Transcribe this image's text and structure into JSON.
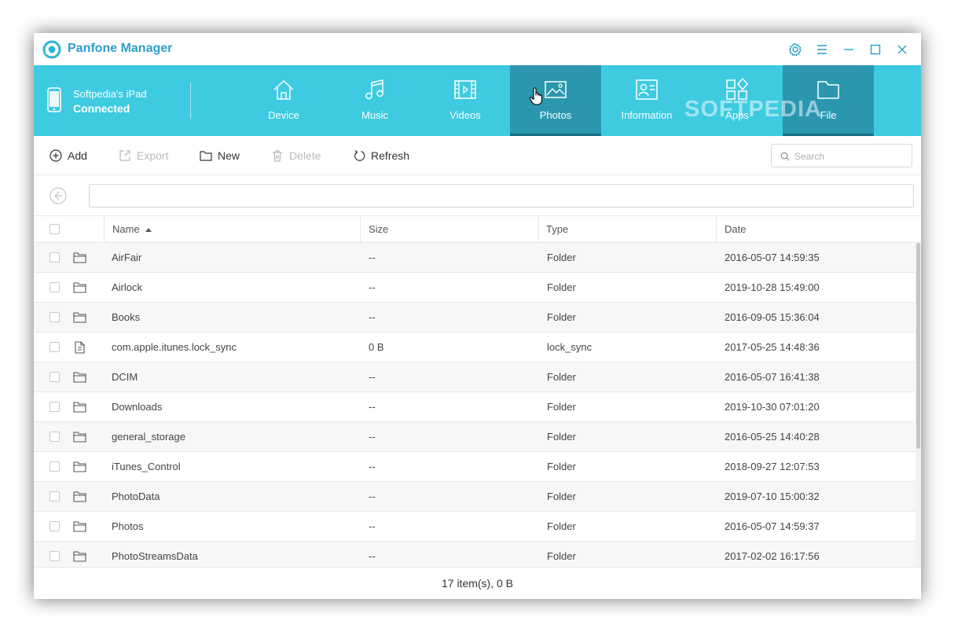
{
  "app": {
    "title": "Panfone Manager"
  },
  "device": {
    "name": "Softpedia's iPad",
    "status": "Connected"
  },
  "nav": {
    "tabs": [
      {
        "label": "Device",
        "icon": "home-icon"
      },
      {
        "label": "Music",
        "icon": "music-note-icon"
      },
      {
        "label": "Videos",
        "icon": "video-icon"
      },
      {
        "label": "Photos",
        "icon": "image-icon"
      },
      {
        "label": "Information",
        "icon": "contact-card-icon"
      },
      {
        "label": "Apps",
        "icon": "apps-grid-icon"
      },
      {
        "label": "File",
        "icon": "folder-icon"
      }
    ],
    "active_tab": "File",
    "hovered_tab": "Photos"
  },
  "watermark": "SOFTPEDIA",
  "toolbar": {
    "add": "Add",
    "export": "Export",
    "new": "New",
    "delete": "Delete",
    "refresh": "Refresh",
    "search_placeholder": "Search"
  },
  "path": {
    "value": ""
  },
  "table": {
    "columns": {
      "name": "Name",
      "size": "Size",
      "type": "Type",
      "date": "Date"
    },
    "sort": {
      "column": "Name",
      "direction": "ascending"
    },
    "rows": [
      {
        "icon": "folder-icon",
        "name": "AirFair",
        "size": "--",
        "type": "Folder",
        "date": "2016-05-07 14:59:35"
      },
      {
        "icon": "folder-icon",
        "name": "Airlock",
        "size": "--",
        "type": "Folder",
        "date": "2019-10-28 15:49:00"
      },
      {
        "icon": "folder-icon",
        "name": "Books",
        "size": "--",
        "type": "Folder",
        "date": "2016-09-05 15:36:04"
      },
      {
        "icon": "document-icon",
        "name": "com.apple.itunes.lock_sync",
        "size": "0 B",
        "type": "lock_sync",
        "date": "2017-05-25 14:48:36"
      },
      {
        "icon": "folder-icon",
        "name": "DCIM",
        "size": "--",
        "type": "Folder",
        "date": "2016-05-07 16:41:38"
      },
      {
        "icon": "folder-icon",
        "name": "Downloads",
        "size": "--",
        "type": "Folder",
        "date": "2019-10-30 07:01:20"
      },
      {
        "icon": "folder-icon",
        "name": "general_storage",
        "size": "--",
        "type": "Folder",
        "date": "2016-05-25 14:40:28"
      },
      {
        "icon": "folder-icon",
        "name": "iTunes_Control",
        "size": "--",
        "type": "Folder",
        "date": "2018-09-27 12:07:53"
      },
      {
        "icon": "folder-icon",
        "name": "PhotoData",
        "size": "--",
        "type": "Folder",
        "date": "2019-07-10 15:00:32"
      },
      {
        "icon": "folder-icon",
        "name": "Photos",
        "size": "--",
        "type": "Folder",
        "date": "2016-05-07 14:59:37"
      },
      {
        "icon": "folder-icon",
        "name": "PhotoStreamsData",
        "size": "--",
        "type": "Folder",
        "date": "2017-02-02 16:17:56"
      }
    ]
  },
  "status": {
    "summary": "17 item(s), 0 B"
  },
  "colors": {
    "accent": "#3ecbe1",
    "active_tab": "#2a97af",
    "brand_text": "#2c9ec9"
  }
}
